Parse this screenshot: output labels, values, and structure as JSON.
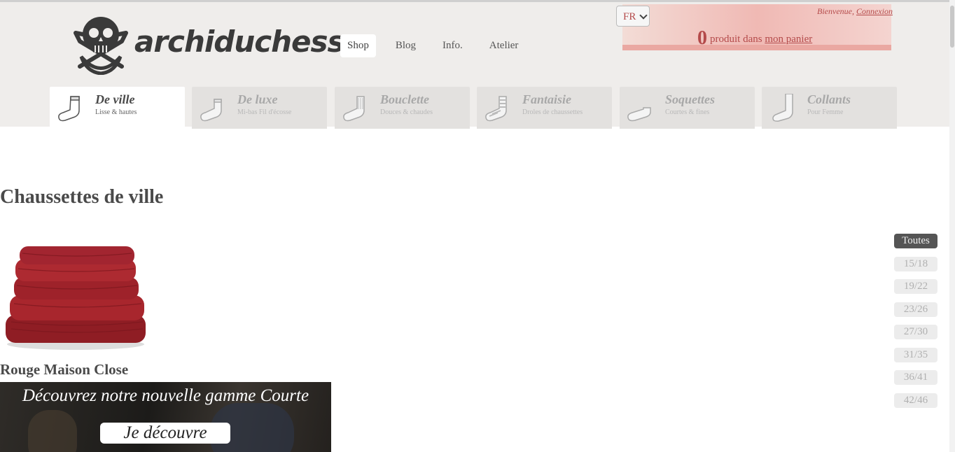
{
  "brand": {
    "name": "archiduchesse"
  },
  "nav": [
    {
      "label": "Shop",
      "active": true
    },
    {
      "label": "Blog"
    },
    {
      "label": "Info."
    },
    {
      "label": "Atelier"
    }
  ],
  "language": {
    "selected": "FR"
  },
  "account": {
    "welcome": "Bienvenue,",
    "login": "Connexion"
  },
  "cart": {
    "count": "0",
    "text": "produit dans",
    "link": "mon panier"
  },
  "categories": [
    {
      "title": "De ville",
      "subtitle": "Lisse & hautes",
      "active": true,
      "icon": "tall-sock-icon"
    },
    {
      "title": "De luxe",
      "subtitle": "Mi-bas Fil d'écosse",
      "icon": "sock-icon"
    },
    {
      "title": "Bouclette",
      "subtitle": "Douces & chaudes",
      "icon": "ribbed-sock-icon"
    },
    {
      "title": "Fantaisie",
      "subtitle": "Droles de chaussettes",
      "icon": "striped-sock-icon"
    },
    {
      "title": "Soquettes",
      "subtitle": "Courtes & fines",
      "icon": "ankle-sock-icon"
    },
    {
      "title": "Collants",
      "subtitle": "Pour Femme",
      "icon": "tights-icon"
    }
  ],
  "page": {
    "title": "Chaussettes de ville"
  },
  "product": {
    "name": "Rouge Maison Close",
    "color": "#a8262d"
  },
  "banner": {
    "headline": "Découvrez notre nouvelle gamme Courte",
    "cta": "Je découvre"
  },
  "sizes": [
    "Toutes",
    "15/18",
    "19/22",
    "23/26",
    "27/30",
    "31/35",
    "36/41",
    "42/46"
  ],
  "colors": {
    "accent": "#b44a4a",
    "header_bg": "#efedeb",
    "tab_bg": "#e3e1df"
  }
}
